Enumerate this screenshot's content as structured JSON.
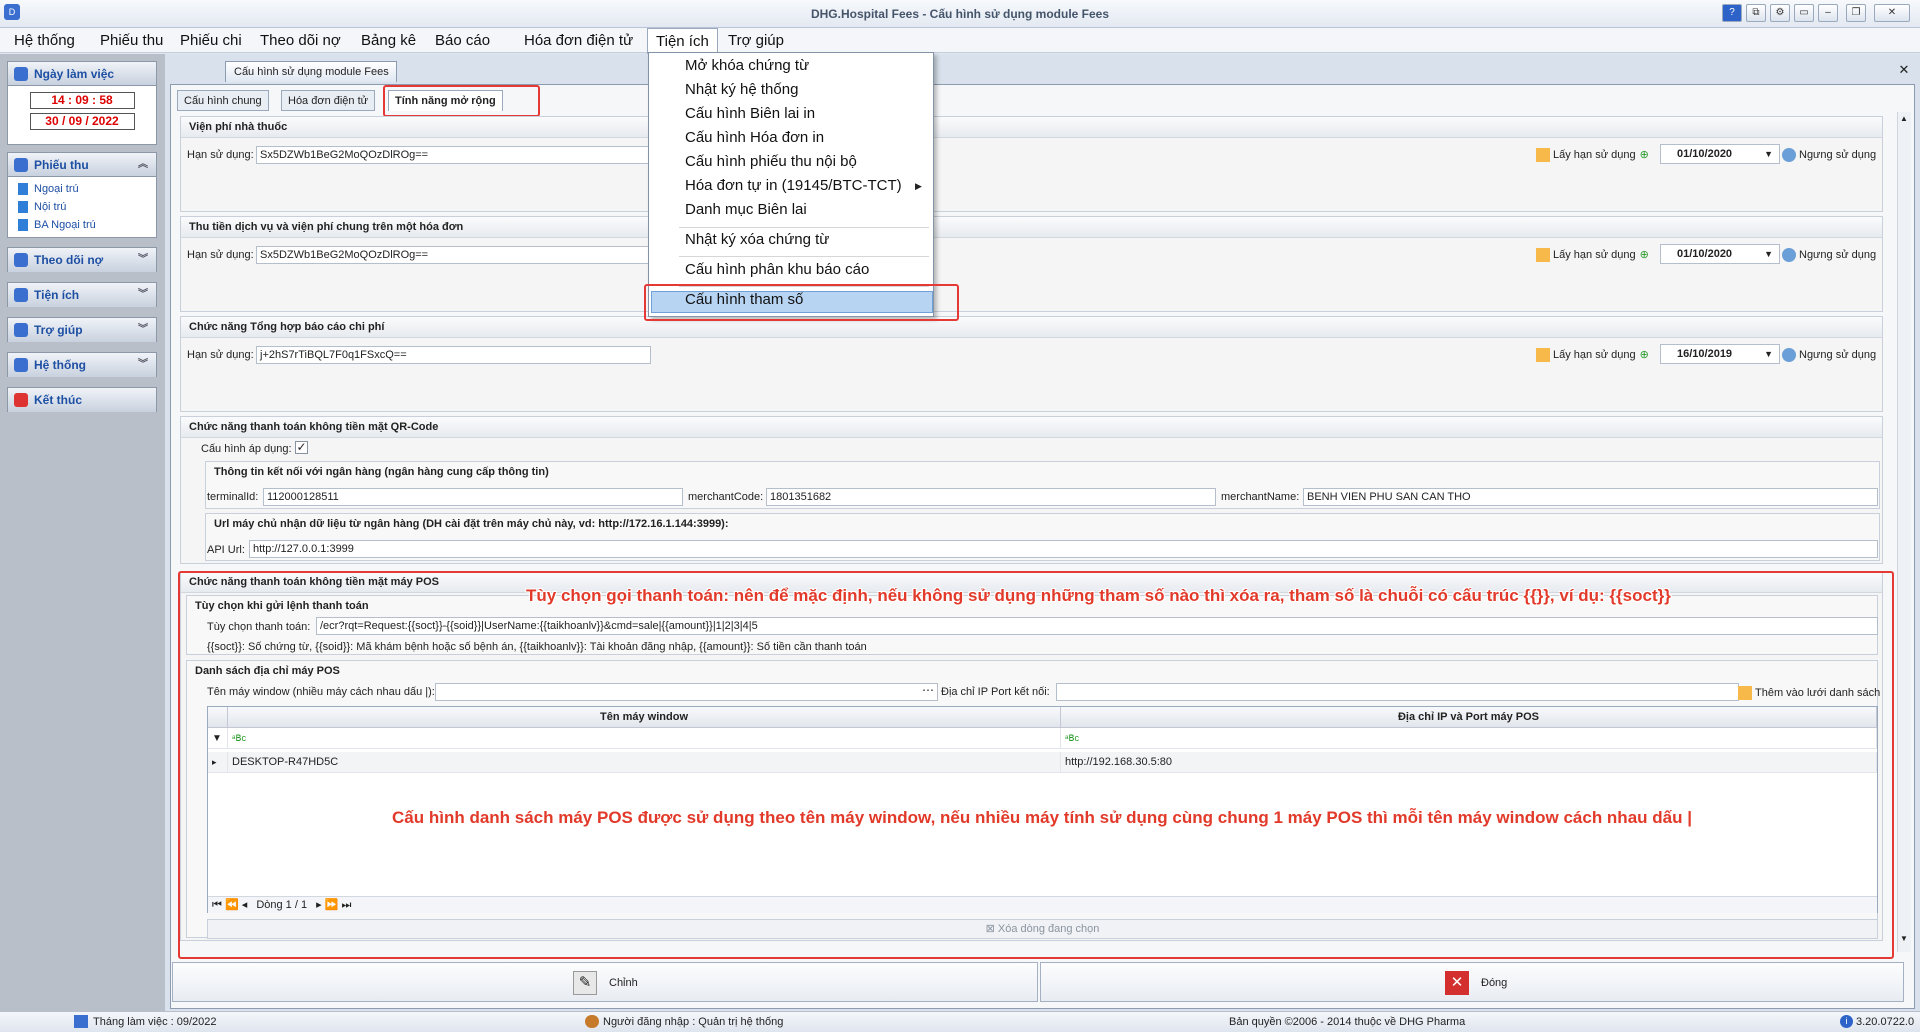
{
  "window": {
    "title": "DHG.Hospital Fees - Cấu hình sử dụng module Fees"
  },
  "menubar": [
    "Hệ thống",
    "Phiếu thu",
    "Phiếu chi",
    "Theo dõi nợ",
    "Bảng kê",
    "Báo cáo",
    "Hóa đơn điện tử",
    "Tiện ích",
    "Trợ giúp"
  ],
  "dropdown": {
    "items": [
      "Mở khóa chứng từ",
      "Nhật ký hệ thống",
      "Cấu hình Biên lai in",
      "Cấu hình Hóa đơn in",
      "Cấu hình phiếu thu nội bộ",
      "Hóa đơn tự in (19145/BTC-TCT)",
      "Danh mục Biên lai",
      "Nhật ký xóa chứng từ",
      "Cấu hình phân khu báo cáo",
      "Cấu hình tham số"
    ],
    "highlighted_index": 9
  },
  "nav": {
    "workday_title": "Ngày làm việc",
    "time": "14 : 09 : 58",
    "date": "30 / 09 / 2022",
    "phieuthu_title": "Phiếu thu",
    "phieuthu_items": [
      "Ngoại trú",
      "Nội trú",
      "BA Ngoại trú"
    ],
    "theodoino": "Theo dõi nợ",
    "tienich": "Tiện ích",
    "trogiup": "Trợ giúp",
    "hethong": "Hệ thống",
    "ketthuc": "Kết thúc"
  },
  "doc_tab": "Cấu hình sử dụng module Fees",
  "content_tabs": [
    "Cấu hình chung",
    "Hóa đơn điện tử",
    "Tính năng mở rộng"
  ],
  "common": {
    "han_su_dung_label": "Hạn sử dụng:",
    "lay_han": "Lấy hạn sử dụng",
    "ngung": "Ngưng sử dụng"
  },
  "groups": [
    {
      "title": "Viện phí nhà thuốc",
      "key": "Sx5DZWb1BeG2MoQOzDlROg==",
      "date": "01/10/2020"
    },
    {
      "title": "Thu tiền dịch vụ và viện phí chung trên một hóa đơn",
      "key": "Sx5DZWb1BeG2MoQOzDlROg==",
      "date": "01/10/2020"
    },
    {
      "title": "Chức năng Tổng hợp báo cáo chi phí",
      "key": "j+2hS7rTiBQL7F0q1FSxcQ==",
      "date": "16/10/2019"
    }
  ],
  "qr": {
    "title": "Chức năng thanh toán không tiền mặt QR-Code",
    "apply_label": "Cấu hình áp dụng:",
    "bank_title": "Thông tin kết nối với ngân hàng (ngân hàng cung cấp thông tin)",
    "terminal_label": "terminalId:",
    "terminal_value": "112000128511",
    "merchant_code_label": "merchantCode:",
    "merchant_code_value": "1801351682",
    "merchant_name_label": "merchantName:",
    "merchant_name_value": "BENH VIEN PHU SAN CAN THO",
    "url_title": "Url máy chủ nhận dữ liệu từ ngân hàng (DH cài đặt trên máy chủ này, vd: http://172.16.1.144:3999):",
    "api_label": "API Url:",
    "api_value": "http://127.0.0.1:3999"
  },
  "pos": {
    "title": "Chức năng thanh toán không tiền mặt máy POS",
    "option_title": "Tùy chọn khi gửi lệnh thanh toán",
    "option_label": "Tùy chọn thanh toán:",
    "option_value": "/ecr?rqt=Request:{{soct}}-{{soid}}|UserName:{{taikhoanlv}}&cmd=sale|{{amount}}|1|2|3|4|5",
    "option_help": "{{soct}}: Số chứng từ, {{soid}}: Mã khám bệnh hoặc số bệnh án, {{taikhoanlv}}: Tài khoản đăng nhập, {{amount}}: Số tiền cần thanh toán",
    "list_title": "Danh sách địa chỉ máy POS",
    "window_label": "Tên máy window (nhiều máy cách nhau dấu |):",
    "ip_label": "Địa chỉ IP",
    "port_label": "Port kết nối:",
    "add_button": "Thêm vào lưới danh sách",
    "col1": "Tên máy window",
    "col2": "Địa chỉ IP và Port máy POS",
    "rows": [
      {
        "window": "DESKTOP-R47HD5C",
        "address": "http://192.168.30.5:80"
      }
    ],
    "pager": "Dòng 1 / 1",
    "delete_button": "Xóa dòng đang chọn"
  },
  "annotations": {
    "top": "Tùy chọn gọi thanh toán: nên để mặc định, nếu không sử dụng những tham số nào thì xóa ra, tham số là chuỗi có cấu trúc {{}}, ví dụ: {{soct}}",
    "bottom": "Cấu hình danh sách máy POS được sử dụng theo tên máy window, nếu nhiều máy tính sử dụng cùng chung 1 máy POS thì mỗi tên máy window cách nhau dấu |"
  },
  "buttons": {
    "edit": "Chỉnh",
    "close": "Đóng"
  },
  "status": {
    "month": "Tháng làm việc : 09/2022",
    "user": "Người đăng nhập : Quản trị hệ thống",
    "copyright": "Bản quyền ©2006 - 2014 thuộc về DHG Pharma",
    "version": "3.20.0722.0"
  }
}
